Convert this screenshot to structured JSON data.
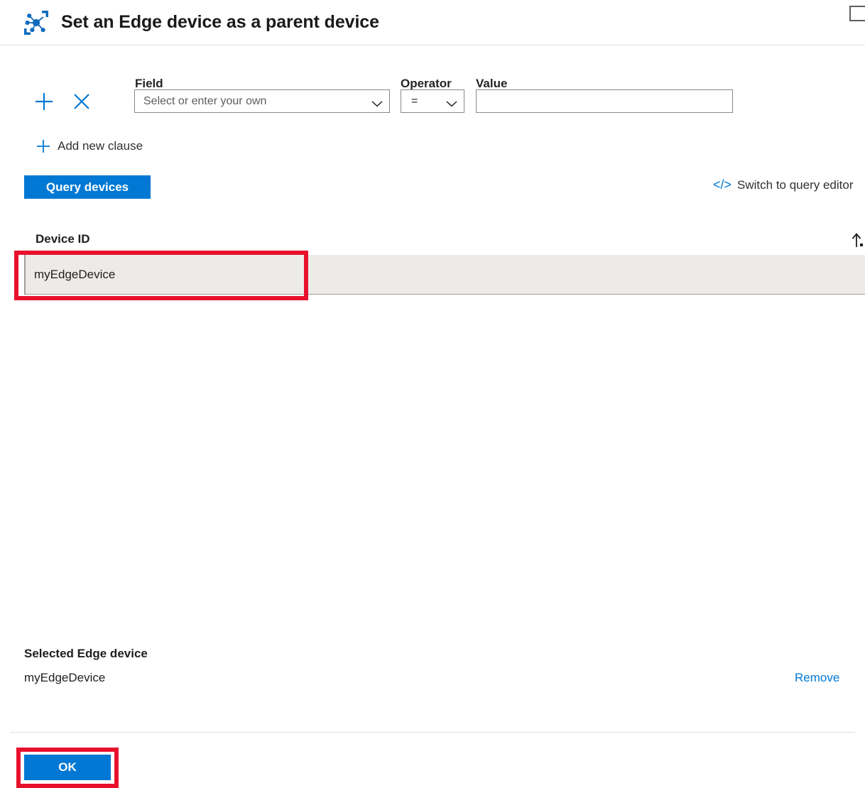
{
  "header": {
    "icon": "iot-edge-device-topology-icon",
    "title": "Set an Edge device as a parent device",
    "maximize_icon": "maximize-icon"
  },
  "filter": {
    "labels": {
      "field": "Field",
      "operator": "Operator",
      "value": "Value"
    },
    "add_clause_icon": "plus-icon",
    "remove_clause_icon": "close-icon",
    "field": {
      "placeholder": "Select or enter your own",
      "value": "",
      "chevron_icon": "chevron-down-icon"
    },
    "operator": {
      "value": "=",
      "chevron_icon": "chevron-down-icon"
    },
    "value_input": {
      "value": "",
      "placeholder": ""
    },
    "add_new_clause": {
      "icon": "plus-icon",
      "label": "Add new clause"
    },
    "query_devices_button": "Query devices",
    "switch_query_editor": {
      "icon": "code-icon",
      "label": "Switch to query editor"
    }
  },
  "table": {
    "columns": [
      "Device ID"
    ],
    "sort_icon": "sort-ascending-arrow-icon",
    "rows": [
      {
        "device_id": "myEdgeDevice",
        "selected": true
      }
    ]
  },
  "selection": {
    "label": "Selected Edge device",
    "device_id": "myEdgeDevice",
    "remove_label": "Remove"
  },
  "footer": {
    "ok_label": "OK"
  },
  "colors": {
    "accent": "#0078d4",
    "annotation": "#e8112d",
    "row_selected_bg": "#edebe9",
    "border": "#8a8886",
    "divider": "#e1dfdd"
  }
}
